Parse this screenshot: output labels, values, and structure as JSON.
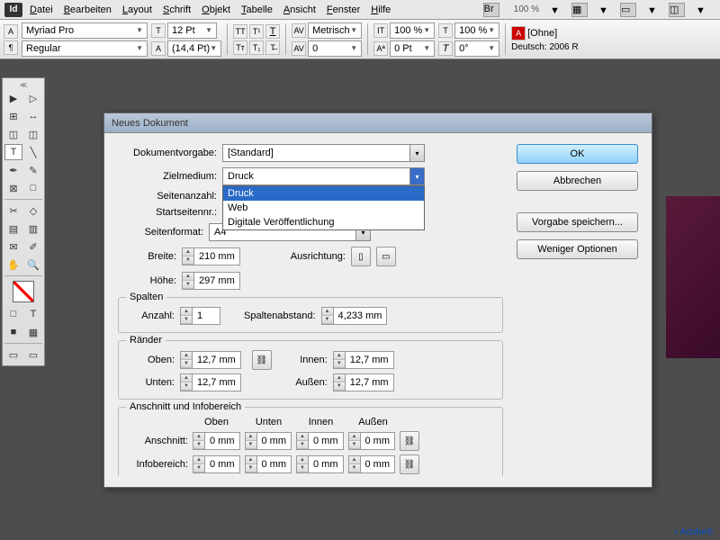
{
  "menu": {
    "items": [
      "Datei",
      "Bearbeiten",
      "Layout",
      "Schrift",
      "Objekt",
      "Tabelle",
      "Ansicht",
      "Fenster",
      "Hilfe"
    ],
    "logo": "Id",
    "zoom": "100 %"
  },
  "toolbar": {
    "font": "Myriad Pro",
    "style": "Regular",
    "size": "12 Pt",
    "leading": "(14,4 Pt)",
    "tracking": "Metrisch",
    "kerning": "0",
    "hscale": "100 %",
    "vscale": "100 %",
    "baseline": "0 Pt",
    "skew": "0°",
    "charStyle": "[Ohne]",
    "lang": "Deutsch: 2006 R"
  },
  "dialog": {
    "title": "Neues Dokument",
    "labels": {
      "preset": "Dokumentvorgabe:",
      "intent": "Zielmedium:",
      "pages": "Seitenanzahl:",
      "start": "Startseitennr.:",
      "pagesize": "Seitenformat:",
      "width": "Breite:",
      "height": "Höhe:",
      "orient": "Ausrichtung:",
      "columns": "Spalten",
      "colcount": "Anzahl:",
      "gutter": "Spaltenabstand:",
      "margins": "Ränder",
      "top": "Oben:",
      "bottom": "Unten:",
      "inside": "Innen:",
      "outside": "Außen:",
      "bleed_section": "Anschnitt und Infobereich",
      "bleed": "Anschnitt:",
      "slug": "Infobereich:",
      "col_top": "Oben",
      "col_bottom": "Unten",
      "col_inside": "Innen",
      "col_outside": "Außen"
    },
    "values": {
      "preset": "[Standard]",
      "intent": "Druck",
      "pagesize": "A4",
      "width": "210 mm",
      "height": "297 mm",
      "colcount": "1",
      "gutter": "4,233 mm",
      "m_top": "12,7 mm",
      "m_bottom": "12,7 mm",
      "m_inside": "12,7 mm",
      "m_outside": "12,7 mm",
      "b_top": "0 mm",
      "b_bottom": "0 mm",
      "b_inside": "0 mm",
      "b_outside": "0 mm",
      "s_top": "0 mm",
      "s_bottom": "0 mm",
      "s_inside": "0 mm",
      "s_outside": "0 mm"
    },
    "intentOptions": [
      "Druck",
      "Web",
      "Digitale Veröffentlichung"
    ],
    "buttons": {
      "ok": "OK",
      "cancel": "Abbrechen",
      "save": "Vorgabe speichern...",
      "less": "Weniger Optionen"
    }
  },
  "footer": "r Adobe®"
}
